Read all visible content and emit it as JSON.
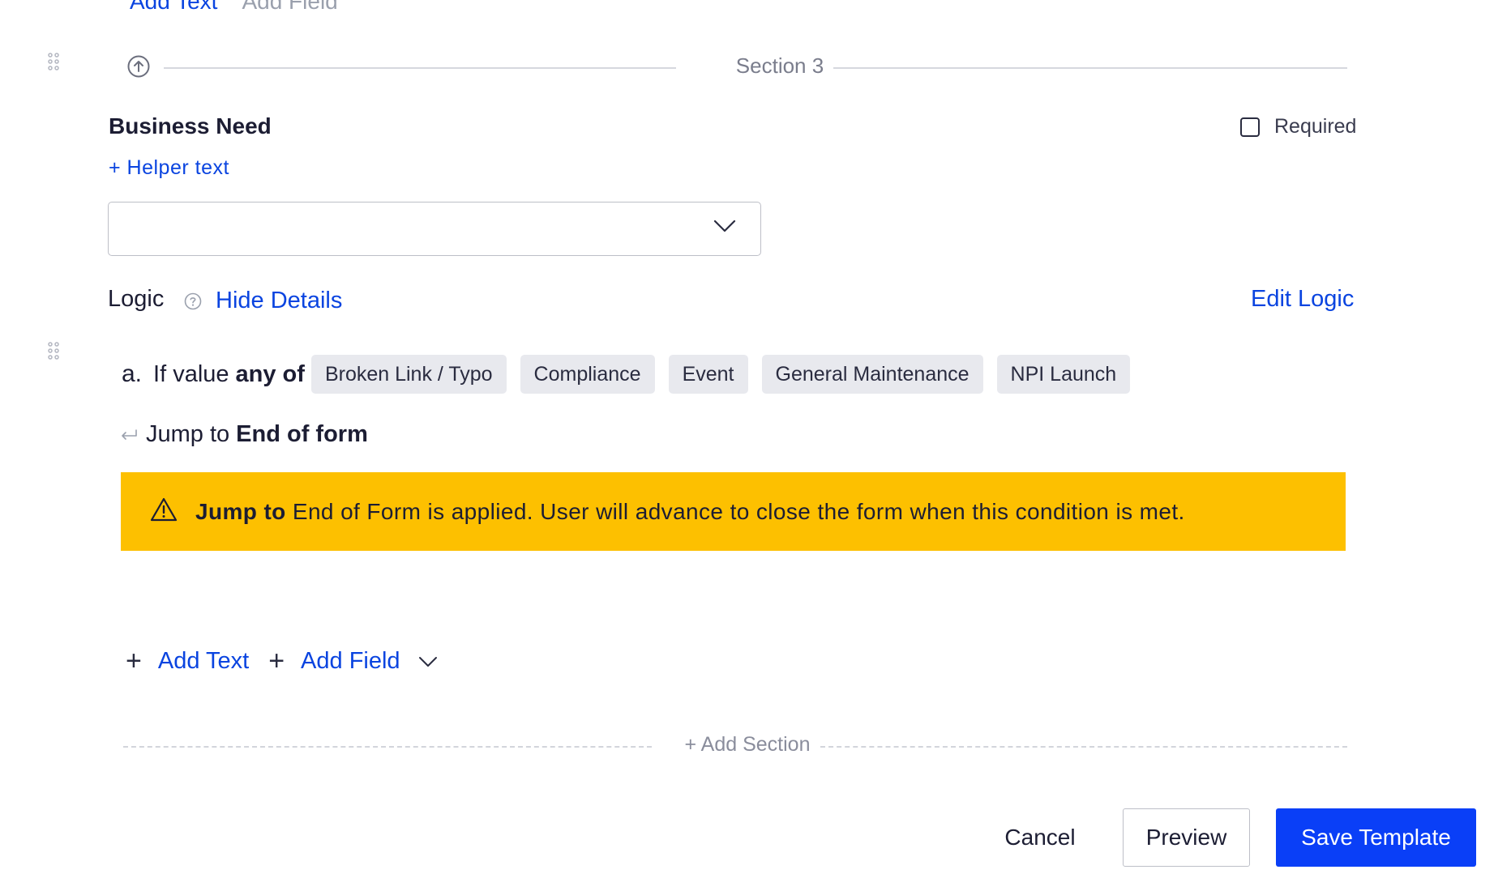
{
  "top_clipped": {
    "add_text": "Add Text",
    "add_field": "Add Field"
  },
  "section": {
    "label": "Section 3"
  },
  "field": {
    "label": "Business Need",
    "required_label": "Required",
    "helper_link": "+ Helper text",
    "select_value": ""
  },
  "logic": {
    "label": "Logic",
    "hide_details": "Hide Details",
    "edit_logic": "Edit Logic"
  },
  "condition": {
    "letter": "a.",
    "prefix": "If value",
    "operator": "any of",
    "values": [
      "Broken Link / Typo",
      "Compliance",
      "Event",
      "General Maintenance",
      "NPI Launch"
    ],
    "jump_prefix": "Jump to",
    "jump_target": "End of form"
  },
  "banner": {
    "bold": "Jump to",
    "text": "End of Form is applied. User will advance to close the form when this condition is met.",
    "color": "#fdc000"
  },
  "add_bar": {
    "add_text": "Add Text",
    "add_field": "Add Field"
  },
  "add_section": "+ Add Section",
  "footer": {
    "cancel": "Cancel",
    "preview": "Preview",
    "save": "Save Template"
  },
  "colors": {
    "accent": "#0a44e0",
    "primary_button": "#0a3ff7"
  }
}
